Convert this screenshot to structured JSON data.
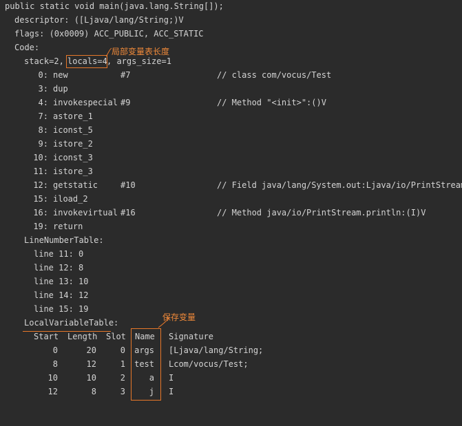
{
  "header": {
    "signature": "public static void main(java.lang.String[]);",
    "descriptor": "descriptor: ([Ljava/lang/String;)V",
    "flags": "flags: (0x0009) ACC_PUBLIC, ACC_STATIC",
    "code_label": "Code:",
    "stack": "stack=2,",
    "locals": "locals=4",
    "args_size": ", args_size=1"
  },
  "instructions": [
    {
      "offset": "0:",
      "op": "new",
      "arg": "#7",
      "comment": "// class com/vocus/Test"
    },
    {
      "offset": "3:",
      "op": "dup",
      "arg": "",
      "comment": ""
    },
    {
      "offset": "4:",
      "op": "invokespecial",
      "arg": "#9",
      "comment": "// Method \"<init>\":()V"
    },
    {
      "offset": "7:",
      "op": "astore_1",
      "arg": "",
      "comment": ""
    },
    {
      "offset": "8:",
      "op": "iconst_5",
      "arg": "",
      "comment": ""
    },
    {
      "offset": "9:",
      "op": "istore_2",
      "arg": "",
      "comment": ""
    },
    {
      "offset": "10:",
      "op": "iconst_3",
      "arg": "",
      "comment": ""
    },
    {
      "offset": "11:",
      "op": "istore_3",
      "arg": "",
      "comment": ""
    },
    {
      "offset": "12:",
      "op": "getstatic",
      "arg": "#10",
      "comment": "// Field java/lang/System.out:Ljava/io/PrintStream;"
    },
    {
      "offset": "15:",
      "op": "iload_2",
      "arg": "",
      "comment": ""
    },
    {
      "offset": "16:",
      "op": "invokevirtual",
      "arg": "#16",
      "comment": "// Method java/io/PrintStream.println:(I)V"
    },
    {
      "offset": "19:",
      "op": "return",
      "arg": "",
      "comment": ""
    }
  ],
  "line_number_table": {
    "title": "LineNumberTable:",
    "lines": [
      "line 11: 0",
      "line 12: 8",
      "line 13: 10",
      "line 14: 12",
      "line 15: 19"
    ]
  },
  "local_variable_table": {
    "title": "LocalVariableTable:",
    "headers": {
      "start": "Start",
      "length": "Length",
      "slot": "Slot",
      "name": "Name",
      "signature": "Signature"
    },
    "rows": [
      {
        "start": "0",
        "length": "20",
        "slot": "0",
        "name": "args",
        "signature": "[Ljava/lang/String;"
      },
      {
        "start": "8",
        "length": "12",
        "slot": "1",
        "name": "test",
        "signature": "Lcom/vocus/Test;"
      },
      {
        "start": "10",
        "length": "10",
        "slot": "2",
        "name": "a",
        "signature": "I"
      },
      {
        "start": "12",
        "length": "8",
        "slot": "3",
        "name": "j",
        "signature": "I"
      }
    ]
  },
  "annotations": {
    "locals_note": "局部变量表长度",
    "vars_note": "保存变量"
  },
  "colors": {
    "background": "#2b2b2b",
    "text": "#d4d4d4",
    "annotation": "#e8782a"
  }
}
